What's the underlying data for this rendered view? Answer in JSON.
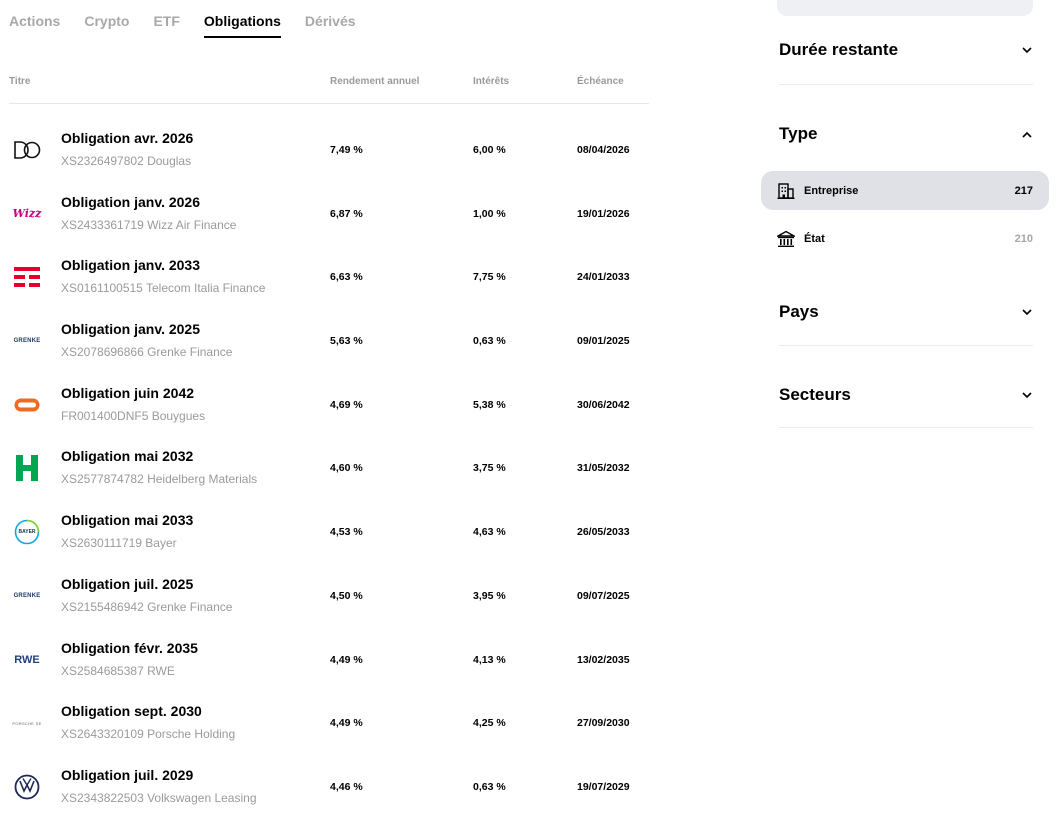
{
  "tabs": [
    {
      "label": "Actions",
      "active": false
    },
    {
      "label": "Crypto",
      "active": false
    },
    {
      "label": "ETF",
      "active": false
    },
    {
      "label": "Obligations",
      "active": true
    },
    {
      "label": "Dérivés",
      "active": false
    }
  ],
  "table": {
    "headers": {
      "title": "Titre",
      "yield": "Rendement annuel",
      "interest": "Intérêts",
      "maturity": "Échéance"
    },
    "rows": [
      {
        "title": "Obligation avr. 2026",
        "sub": "XS2326497802 Douglas",
        "yield": "7,49 %",
        "interest": "6,00 %",
        "maturity": "08/04/2026",
        "logo": "douglas-logo"
      },
      {
        "title": "Obligation janv. 2026",
        "sub": "XS2433361719 Wizz Air Finance",
        "yield": "6,87 %",
        "interest": "1,00 %",
        "maturity": "19/01/2026",
        "logo": "wizz-air-logo"
      },
      {
        "title": "Obligation janv. 2033",
        "sub": "XS0161100515 Telecom Italia Finance",
        "yield": "6,63 %",
        "interest": "7,75 %",
        "maturity": "24/01/2033",
        "logo": "telecom-italia-logo"
      },
      {
        "title": "Obligation janv. 2025",
        "sub": "XS2078696866 Grenke Finance",
        "yield": "5,63 %",
        "interest": "0,63 %",
        "maturity": "09/01/2025",
        "logo": "grenke-logo"
      },
      {
        "title": "Obligation juin 2042",
        "sub": "FR001400DNF5 Bouygues",
        "yield": "4,69 %",
        "interest": "5,38 %",
        "maturity": "30/06/2042",
        "logo": "bouygues-logo"
      },
      {
        "title": "Obligation mai 2032",
        "sub": "XS2577874782 Heidelberg Materials",
        "yield": "4,60 %",
        "interest": "3,75 %",
        "maturity": "31/05/2032",
        "logo": "heidelberg-logo"
      },
      {
        "title": "Obligation mai 2033",
        "sub": "XS2630111719 Bayer",
        "yield": "4,53 %",
        "interest": "4,63 %",
        "maturity": "26/05/2033",
        "logo": "bayer-logo"
      },
      {
        "title": "Obligation juil. 2025",
        "sub": "XS2155486942 Grenke Finance",
        "yield": "4,50 %",
        "interest": "3,95 %",
        "maturity": "09/07/2025",
        "logo": "grenke-logo"
      },
      {
        "title": "Obligation févr. 2035",
        "sub": "XS2584685387 RWE",
        "yield": "4,49 %",
        "interest": "4,13 %",
        "maturity": "13/02/2035",
        "logo": "rwe-logo"
      },
      {
        "title": "Obligation sept. 2030",
        "sub": "XS2643320109 Porsche Holding",
        "yield": "4,49 %",
        "interest": "4,25 %",
        "maturity": "27/09/2030",
        "logo": "porsche-logo"
      },
      {
        "title": "Obligation juil. 2029",
        "sub": "XS2343822503 Volkswagen Leasing",
        "yield": "4,46 %",
        "interest": "0,63 %",
        "maturity": "19/07/2029",
        "logo": "volkswagen-logo"
      }
    ]
  },
  "logo_text": {
    "wizz": "Wizz",
    "grenke": "GRENKE",
    "bayer": "BAYER",
    "rwe": "RWE",
    "porsche": "PORSCHE SE"
  },
  "filters": {
    "duration": {
      "label": "Durée restante"
    },
    "type": {
      "label": "Type",
      "options": [
        {
          "label": "Entreprise",
          "count": "217",
          "selected": true,
          "icon": "building-icon"
        },
        {
          "label": "État",
          "count": "210",
          "selected": false,
          "icon": "government-icon"
        }
      ]
    },
    "country": {
      "label": "Pays"
    },
    "sectors": {
      "label": "Secteurs"
    }
  },
  "colors": {
    "accent": "#000000",
    "muted": "#9a9a9a",
    "selected_bg": "#dfe1e6"
  }
}
